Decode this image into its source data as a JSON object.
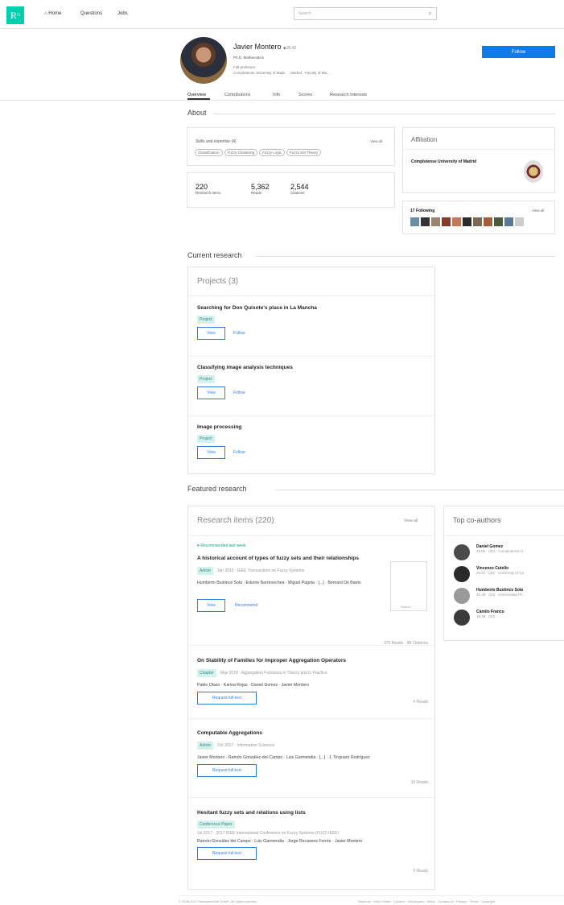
{
  "nav": {
    "logo": "R",
    "logo_sup": "G",
    "home": "Home",
    "questions": "Questions",
    "jobs": "Jobs",
    "search_placeholder": "Search"
  },
  "profile": {
    "name": "Javier Montero",
    "score": "36.42",
    "degree": "Ph.D. Mathematics",
    "position": "Full professor",
    "institution": "Complutense University of Madr... , Madrid · Faculty of Ma...",
    "follow": "Follow"
  },
  "tabs": [
    "Overview",
    "Contributions",
    "Info",
    "Scores",
    "Research Interests"
  ],
  "about": {
    "heading": "About",
    "skills_label": "Skills and expertise (4)",
    "view_all": "View all",
    "skills": [
      "Classification",
      "Fuzzy Clustering",
      "Fuzzy Logic",
      "Fuzzy Set Theory"
    ],
    "stats": [
      {
        "value": "220",
        "label": "Research items"
      },
      {
        "value": "5,362",
        "label": "Reads"
      },
      {
        "value": "2,544",
        "label": "Citations"
      }
    ]
  },
  "affiliation": {
    "heading": "Affiliation",
    "name": "Complutense University of Madrid"
  },
  "following": {
    "label": "17 Following",
    "view_all": "View all"
  },
  "current": {
    "heading": "Current research",
    "projects_title": "Projects (3)",
    "projects": [
      {
        "title": "Searching for Don Quixote's place in La Mancha",
        "badge": "Project",
        "view": "View",
        "follow": "Follow"
      },
      {
        "title": "Classifying image analysis techniques",
        "badge": "Project",
        "view": "View",
        "follow": "Follow"
      },
      {
        "title": "Image processing",
        "badge": "Project",
        "view": "View",
        "follow": "Follow"
      }
    ]
  },
  "featured": {
    "heading": "Featured research",
    "items_title": "Research items (220)",
    "view_all": "View all",
    "recommended": "Recommended last week",
    "items": [
      {
        "title": "A historical account of types of fuzzy sets and their relationships",
        "type": "Article",
        "meta": "Jan 2015 · IEEE Transactions on Fuzzy Systems",
        "authors": "Humberto Bustince Sola · Edurne Barrenechea · Miguel Pagola · [...] · Bernard De Baets",
        "btn": "View",
        "btn2": "Recommend",
        "stats": "376 Reads · 98 Citations",
        "source": "Source"
      },
      {
        "title": "On Stability of Families for Improper Aggregation Operators",
        "type": "Chapter",
        "meta": "May 2018 · Aggregation Functions in Theory and in Practice",
        "authors": "Pablo Olaso · Karina Rojas · Daniel Gomez · Javier Montero",
        "btn": "Request full-text",
        "stats": "4 Reads"
      },
      {
        "title": "Computable Aggregations",
        "type": "Article",
        "meta": "Oct 2017 · Information Sciences",
        "authors": "Javier Montero · Ramón González-del-Campo · Luis Garmendia · [...] · J. Tinguaro Rodríguez",
        "btn": "Request full-text",
        "stats": "16 Reads"
      },
      {
        "title": "Hesitant fuzzy sets and relations using lists",
        "type": "Conference Paper",
        "meta": "Jul 2017 · 2017 IEEE International Conference on Fuzzy Systems (FUZZ-IEEE)",
        "authors": "Ramón González del Campo · Luis Garmendia · Jorge Recasens Ferrés · Javier Montero",
        "btn": "Request full-text",
        "stats": "5 Reads"
      }
    ]
  },
  "coauthors": {
    "heading": "Top co-authors",
    "people": [
      {
        "name": "Daniel Gomez",
        "meta": "28.96 · (92) · Complutense U"
      },
      {
        "name": "Vincenzo Cutello",
        "meta": "26.40 · (26) · University of Ca"
      },
      {
        "name": "Humberto Bustince Sola",
        "meta": "41.38 · (23) · Universidad Pú"
      },
      {
        "name": "Camilo Franco",
        "meta": "18.28 · (22)"
      }
    ]
  },
  "footer": {
    "copyright": "© 2008-2017 ResearchGate GmbH. All rights reserved.",
    "links": "About us · Help Center · Careers · Developers · News · Contact us · Privacy · Terms · Copyright"
  }
}
